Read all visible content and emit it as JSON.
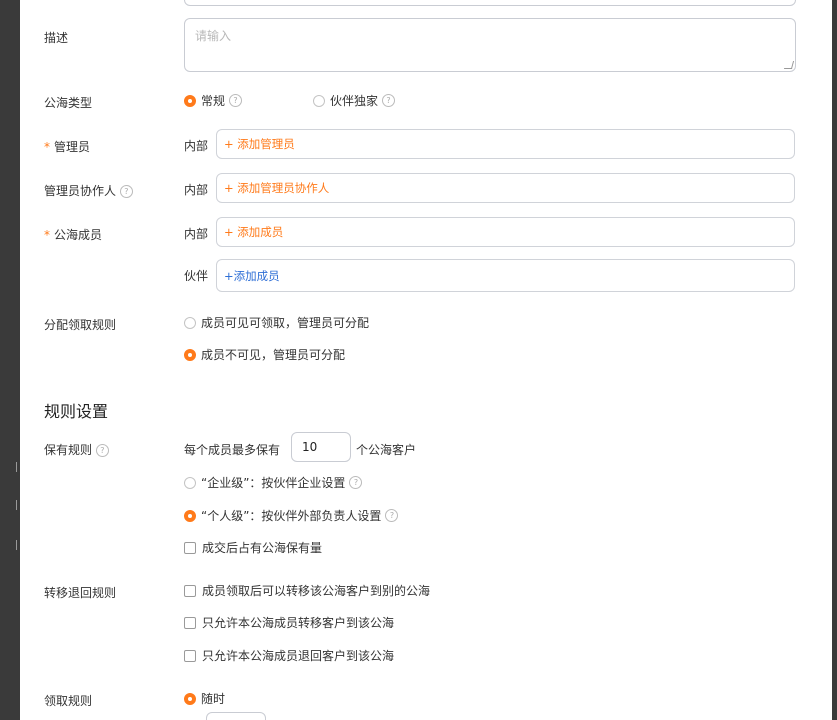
{
  "form": {
    "description_label": "描述",
    "description_placeholder": "请输入",
    "type_label": "公海类型",
    "type_options": [
      "常规",
      "伙伴独家"
    ],
    "type_selected": "常规",
    "admin_label": "管理员",
    "admin_collab_label": "管理员协作人",
    "members_label": "公海成员",
    "internal_label": "内部",
    "partner_label": "伙伴",
    "add_admin": "+ 添加管理员",
    "add_admin_collab": "+ 添加管理员协作人",
    "add_member_internal": "+ 添加成员",
    "add_member_partner": "+添加成员",
    "distribution_label": "分配领取规则",
    "distribution_options": [
      "成员可见可领取，管理员可分配",
      "成员不可见，管理员可分配"
    ],
    "distribution_selected": "成员不可见，管理员可分配"
  },
  "rules": {
    "section_title": "规则设置",
    "retention_label": "保有规则",
    "retention_prefix": "每个成员最多保有",
    "retention_value": "10",
    "retention_suffix": "个公海客户",
    "retention_levels": [
      "“企业级”：按伙伴企业设置",
      "“个人级”：按伙伴外部负责人设置"
    ],
    "retention_level_selected": "“个人级”：按伙伴外部负责人设置",
    "deal_occupy_label": "成交后占有公海保有量",
    "deal_occupy_checked": false,
    "transfer_label": "转移退回规则",
    "transfer_options": [
      {
        "label": "成员领取后可以转移该公海客户到别的公海",
        "checked": false
      },
      {
        "label": "只允许本公海成员转移客户到该公海",
        "checked": false
      },
      {
        "label": "只允许本公海成员退回客户到该公海",
        "checked": false
      }
    ],
    "claim_label": "领取规则",
    "claim_option": "随时",
    "claim_selected": true
  },
  "colors": {
    "accent": "#ff7a1a",
    "link_blue": "#2f6fd6"
  }
}
